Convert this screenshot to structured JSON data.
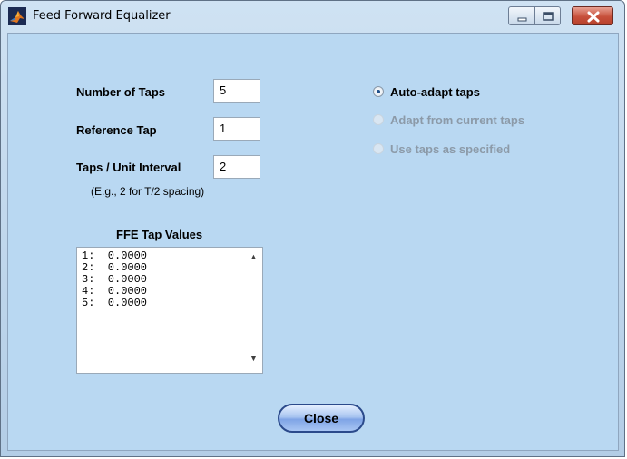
{
  "window": {
    "title": "Feed Forward Equalizer",
    "colors": {
      "client_bg": "#b9d8f2",
      "close_button": "#c7503b"
    }
  },
  "settings": {
    "number_of_taps_label": "Number of Taps",
    "number_of_taps_value": "5",
    "reference_tap_label": "Reference Tap",
    "reference_tap_value": "1",
    "taps_per_ui_label": "Taps / Unit Interval",
    "taps_per_ui_value": "2",
    "taps_per_ui_note": "(E.g., 2 for T/2 spacing)"
  },
  "tap_values": {
    "heading": "FFE Tap Values",
    "items": [
      "1:  0.0000",
      "2:  0.0000",
      "3:  0.0000",
      "4:  0.0000",
      "5:  0.0000"
    ]
  },
  "adapt_mode": {
    "options": [
      {
        "label": "Auto-adapt taps",
        "selected": true,
        "enabled": true
      },
      {
        "label": "Adapt from current taps",
        "selected": false,
        "enabled": false
      },
      {
        "label": "Use taps as specified",
        "selected": false,
        "enabled": false
      }
    ]
  },
  "buttons": {
    "close_label": "Close"
  }
}
